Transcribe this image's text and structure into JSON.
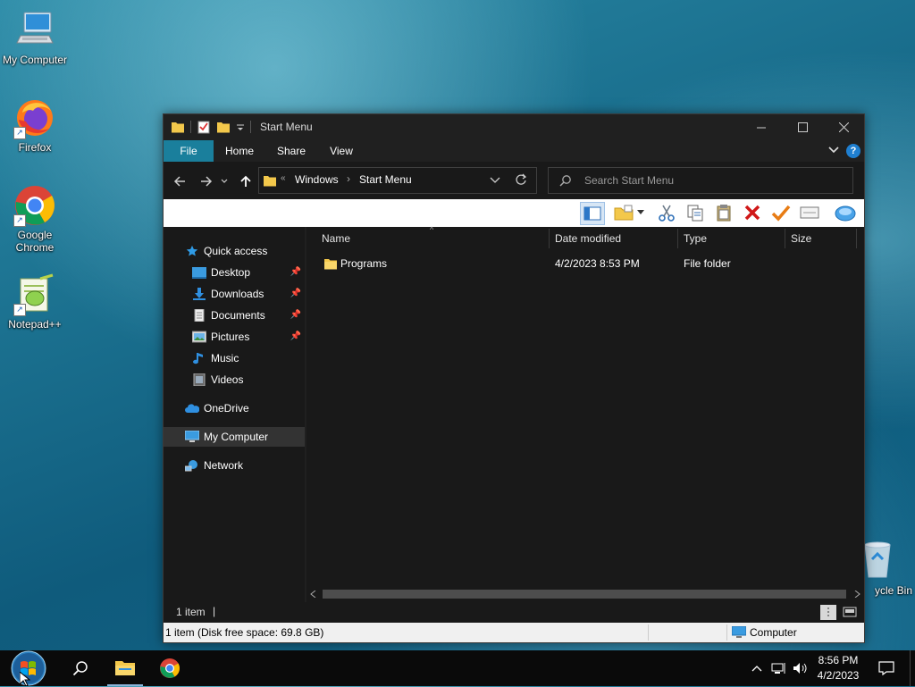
{
  "desktop": {
    "icons": [
      {
        "label": "My Computer",
        "icon": "computer-icon"
      },
      {
        "label": "Firefox",
        "icon": "firefox-icon"
      },
      {
        "label": "Google Chrome",
        "icon": "chrome-icon"
      },
      {
        "label": "Notepad++",
        "icon": "notepadpp-icon"
      },
      {
        "label": "ycle Bin",
        "icon": "recycle-bin-icon"
      }
    ]
  },
  "window": {
    "title": "Start Menu",
    "ribbon_tabs": [
      "File",
      "Home",
      "Share",
      "View"
    ],
    "breadcrumb": {
      "overflow": "«",
      "items": [
        "Windows",
        "Start Menu"
      ]
    },
    "search_placeholder": "Search Start Menu",
    "nav_pane": {
      "items": [
        {
          "label": "Quick access",
          "icon": "star-icon"
        },
        {
          "label": "Desktop",
          "icon": "desktop-icon",
          "pinned": true
        },
        {
          "label": "Downloads",
          "icon": "download-icon",
          "pinned": true
        },
        {
          "label": "Documents",
          "icon": "document-icon",
          "pinned": true
        },
        {
          "label": "Pictures",
          "icon": "pictures-icon",
          "pinned": true
        },
        {
          "label": "Music",
          "icon": "music-icon"
        },
        {
          "label": "Videos",
          "icon": "videos-icon"
        },
        {
          "label": "OneDrive",
          "icon": "cloud-icon"
        },
        {
          "label": "My Computer",
          "icon": "computer-icon",
          "selected": true
        },
        {
          "label": "Network",
          "icon": "network-icon"
        }
      ]
    },
    "columns": [
      "Name",
      "Date modified",
      "Type",
      "Size"
    ],
    "files": [
      {
        "name": "Programs",
        "date": "4/2/2023 8:53 PM",
        "type": "File folder",
        "size": ""
      }
    ],
    "status": {
      "count": "1 item",
      "separator": "|"
    },
    "bottom": {
      "info": "1 item (Disk free space: 69.8 GB)",
      "location": "Computer"
    }
  },
  "taskbar": {
    "time": "8:56 PM",
    "date": "4/2/2023"
  },
  "colors": {
    "accent": "#1a7f9c",
    "window_bg": "#191919",
    "title_bg": "#202020"
  }
}
